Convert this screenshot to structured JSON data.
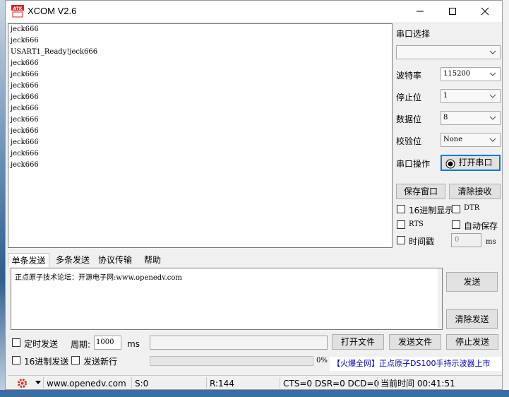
{
  "window": {
    "title": "XCOM V2.6",
    "logo_text": "ATK"
  },
  "receive": {
    "lines": [
      "jeck666",
      "jeck666",
      "USART1_Ready!jeck666",
      "jeck666",
      "jeck666",
      "jeck666",
      "jeck666",
      "jeck666",
      "jeck666",
      "jeck666",
      "jeck666",
      "jeck666",
      "jeck666"
    ]
  },
  "settings": {
    "port_label": "串口选择",
    "port_value": "",
    "baud_label": "波特率",
    "baud_value": "115200",
    "stop_label": "停止位",
    "stop_value": "1",
    "data_label": "数据位",
    "data_value": "8",
    "parity_label": "校验位",
    "parity_value": "None",
    "op_label": "串口操作",
    "open_port": "打开串口",
    "save_window": "保存窗口",
    "clear_receive": "清除接收",
    "hex_display": "16进制显示",
    "dtr": "DTR",
    "rts": "RTS",
    "auto_save": "自动保存",
    "timestamp": "时间戳",
    "timestamp_value": "0",
    "ms": "ms"
  },
  "tabs": [
    "单条发送",
    "多条发送",
    "协议传输",
    "帮助"
  ],
  "send": {
    "text": "正点原子技术论坛：开源电子网:www.openedv.com",
    "send_button": "发送",
    "clear_send": "清除发送",
    "timed_send": "定时发送",
    "period_label": "周期:",
    "period_value": "1000",
    "ms": "ms",
    "hex_send": "16进制发送",
    "send_newline": "发送新行",
    "open_file": "打开文件",
    "send_file": "发送文件",
    "stop_send": "停止发送",
    "progress_text": "0%",
    "progress": 0,
    "ad_text": "【火爆全网】正点原子DS100手持示波器上市"
  },
  "status": {
    "url": "www.openedv.com",
    "sent": "S:0",
    "received": "R:144",
    "signals": "CTS=0 DSR=0 DCD=0",
    "time": "当前时间 00:41:51"
  },
  "colors": {
    "accent": "#0000c0",
    "gear": "#d93025",
    "window_bg": "#f0f0f0"
  }
}
